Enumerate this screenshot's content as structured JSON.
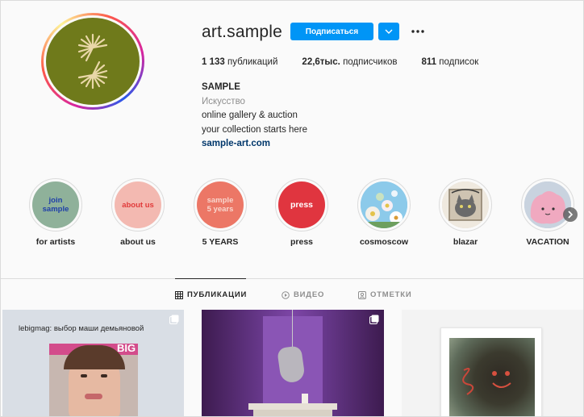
{
  "profile": {
    "username": "art.sample",
    "follow_label": "Подписаться",
    "stats": {
      "posts_count": "1 133",
      "posts_label": "публикаций",
      "followers_count": "22,6тыс.",
      "followers_label": "подписчиков",
      "following_count": "811",
      "following_label": "подписок"
    },
    "bio": {
      "name": "SAMPLE",
      "category": "Искусство",
      "line1": "online gallery & auction",
      "line2": "your collection starts here",
      "link": "sample-art.com"
    }
  },
  "highlights": [
    {
      "label": "for artists",
      "cover_text": "join\nsample",
      "cover_color": "#8fb19a",
      "text_color": "#1f3fa8"
    },
    {
      "label": "about us",
      "cover_text": "about us",
      "cover_color": "#f3b9b1",
      "text_color": "#e13a3a"
    },
    {
      "label": "5 YEARS",
      "cover_text": "sample\n5 years",
      "cover_color": "#ec7766",
      "text_color": "#f9d6cd"
    },
    {
      "label": "press",
      "cover_text": "press",
      "cover_color": "#e0353f",
      "text_color": "#ffffff"
    },
    {
      "label": "cosmoscow",
      "cover_text": "",
      "cover_color": "#8ccaea",
      "text_color": ""
    },
    {
      "label": "blazar",
      "cover_text": "",
      "cover_color": "#d9d1c4",
      "text_color": ""
    },
    {
      "label": "VACATION",
      "cover_text": "",
      "cover_color": "#b7c4d6",
      "text_color": ""
    }
  ],
  "tabs": [
    {
      "label": "ПУБЛИКАЦИИ",
      "icon": "grid-icon",
      "active": true
    },
    {
      "label": "ВИДЕО",
      "icon": "play-icon",
      "active": false
    },
    {
      "label": "ОТМЕТКИ",
      "icon": "tag-icon",
      "active": false
    }
  ],
  "posts": [
    {
      "caption": "lebigmag: выбор маши демьяновой",
      "magazine_title": "BIG"
    }
  ],
  "colors": {
    "accent": "#0095f6",
    "avatar_bg": "#6f7a1b",
    "avatar_logo": "#e9d7a8"
  }
}
